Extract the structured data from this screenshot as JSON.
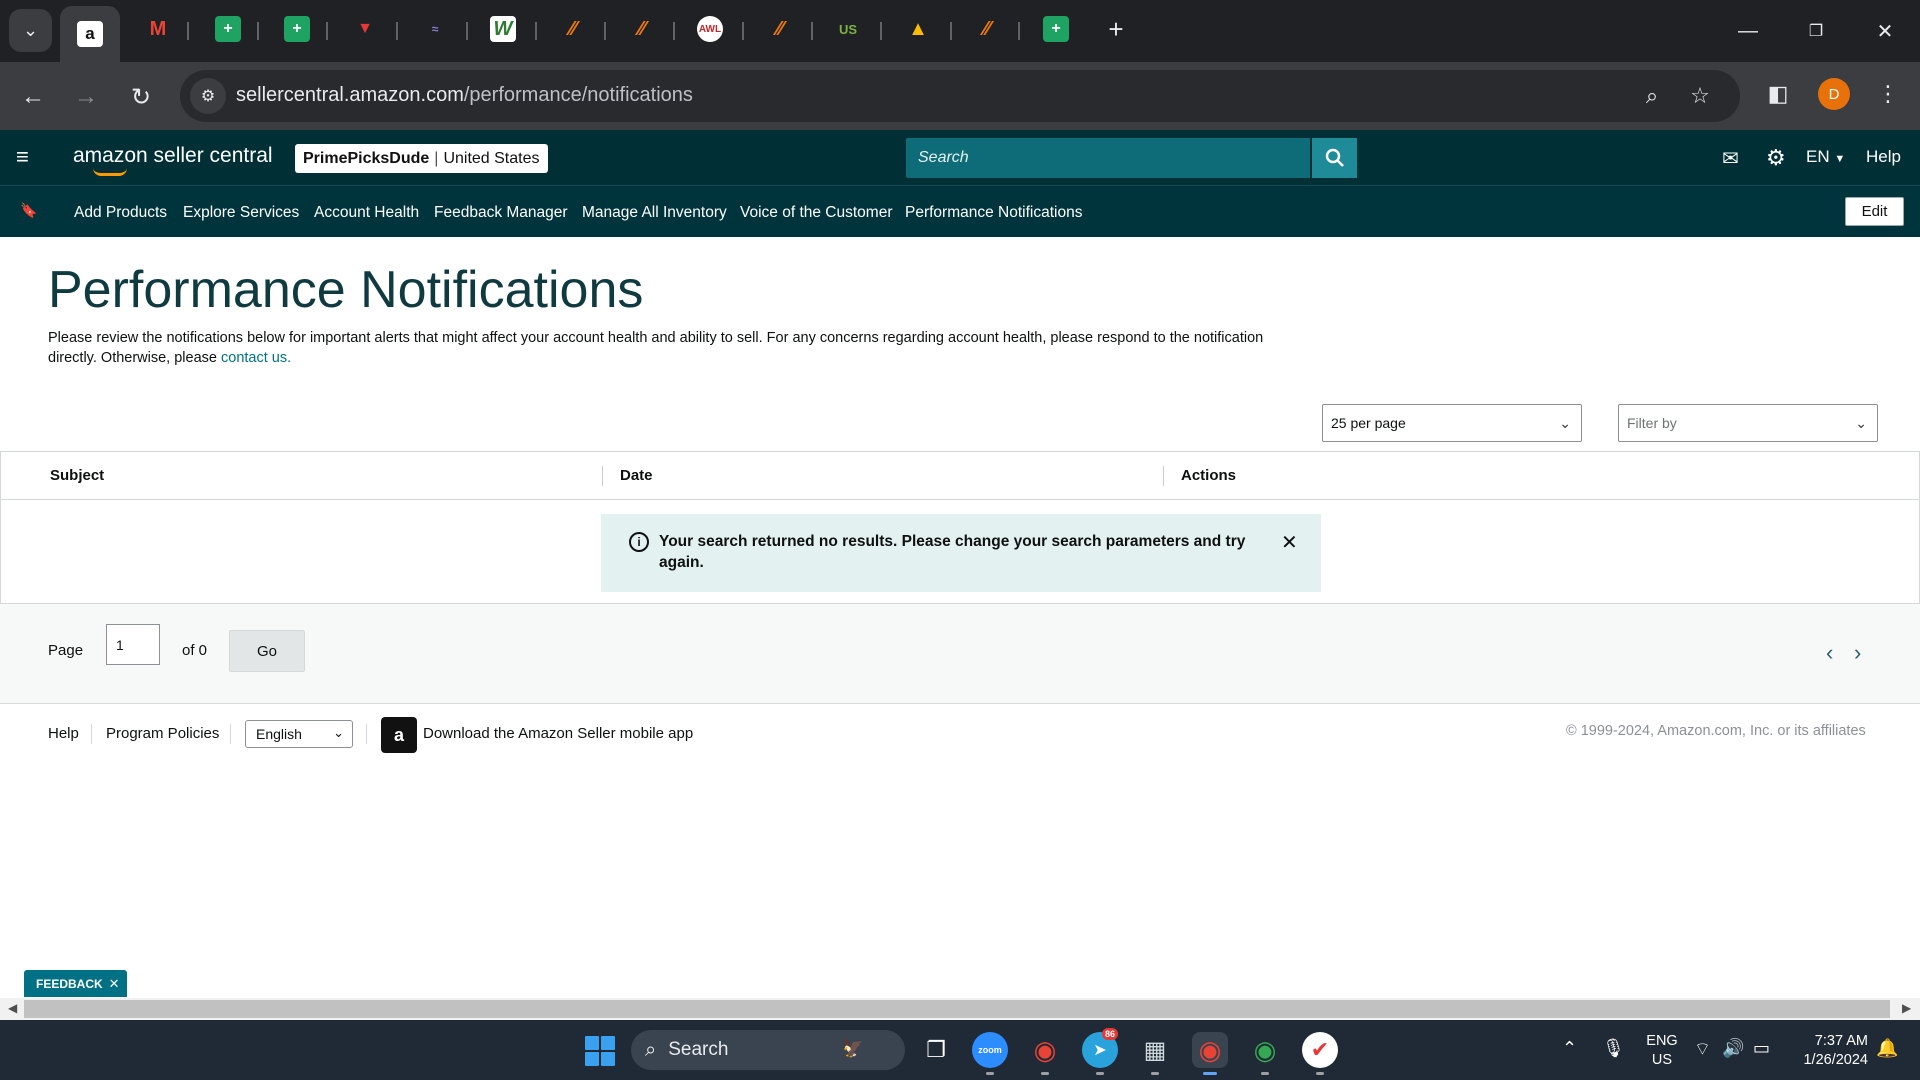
{
  "browser": {
    "url_host": "sellercentral.amazon.com",
    "url_path": "/performance/notifications",
    "profile_initial": "D",
    "new_tab": "+",
    "tab_icons": [
      "amazon-favicon",
      "gmail-favicon",
      "sheets-favicon",
      "sheets-favicon",
      "redbadge-favicon",
      "swoosh-favicon",
      "wiki-favicon",
      "keepa-favicon",
      "keepa-favicon",
      "awl-favicon",
      "keepa-favicon",
      "usfoods-favicon",
      "drive-favicon",
      "keepa-favicon",
      "sheets-favicon"
    ]
  },
  "header": {
    "logo_text": "amazon seller central",
    "store_name": "PrimePicksDude",
    "store_region": "United States",
    "search_placeholder": "Search",
    "language": "EN",
    "help": "Help"
  },
  "nav": {
    "links": [
      "Add Products",
      "Explore Services",
      "Account Health",
      "Feedback Manager",
      "Manage All Inventory",
      "Voice of the Customer",
      "Performance Notifications"
    ],
    "edit": "Edit"
  },
  "page": {
    "title": "Performance Notifications",
    "description": "Please review the notifications below for important alerts that might affect your account health and ability to sell. For any concerns regarding account health, please respond to the notification directly. Otherwise, please",
    "contact_link": "contact us."
  },
  "controls": {
    "per_page": "25 per page",
    "filter_placeholder": "Filter by"
  },
  "table": {
    "columns": [
      "Subject",
      "Date",
      "Actions"
    ],
    "empty_message": "Your search returned no results. Please change your search parameters and try again."
  },
  "pager": {
    "page_label": "Page",
    "page_value": "1",
    "of_label": "of 0",
    "go": "Go"
  },
  "footer": {
    "help": "Help",
    "program_policies": "Program Policies",
    "language": "English",
    "app_promo": "Download the Amazon Seller mobile app",
    "copyright": "© 1999-2024, Amazon.com, Inc. or its affiliates"
  },
  "feedback": "FEEDBACK",
  "taskbar": {
    "search": "Search",
    "telegram_badge": "86",
    "lang_top": "ENG",
    "lang_bottom": "US",
    "time": "7:37 AM",
    "date": "1/26/2024"
  },
  "colors": {
    "header_bg": "#002f36",
    "nav_bg": "#00343c",
    "link": "#007185",
    "alert_bg": "#e3f1f1"
  }
}
